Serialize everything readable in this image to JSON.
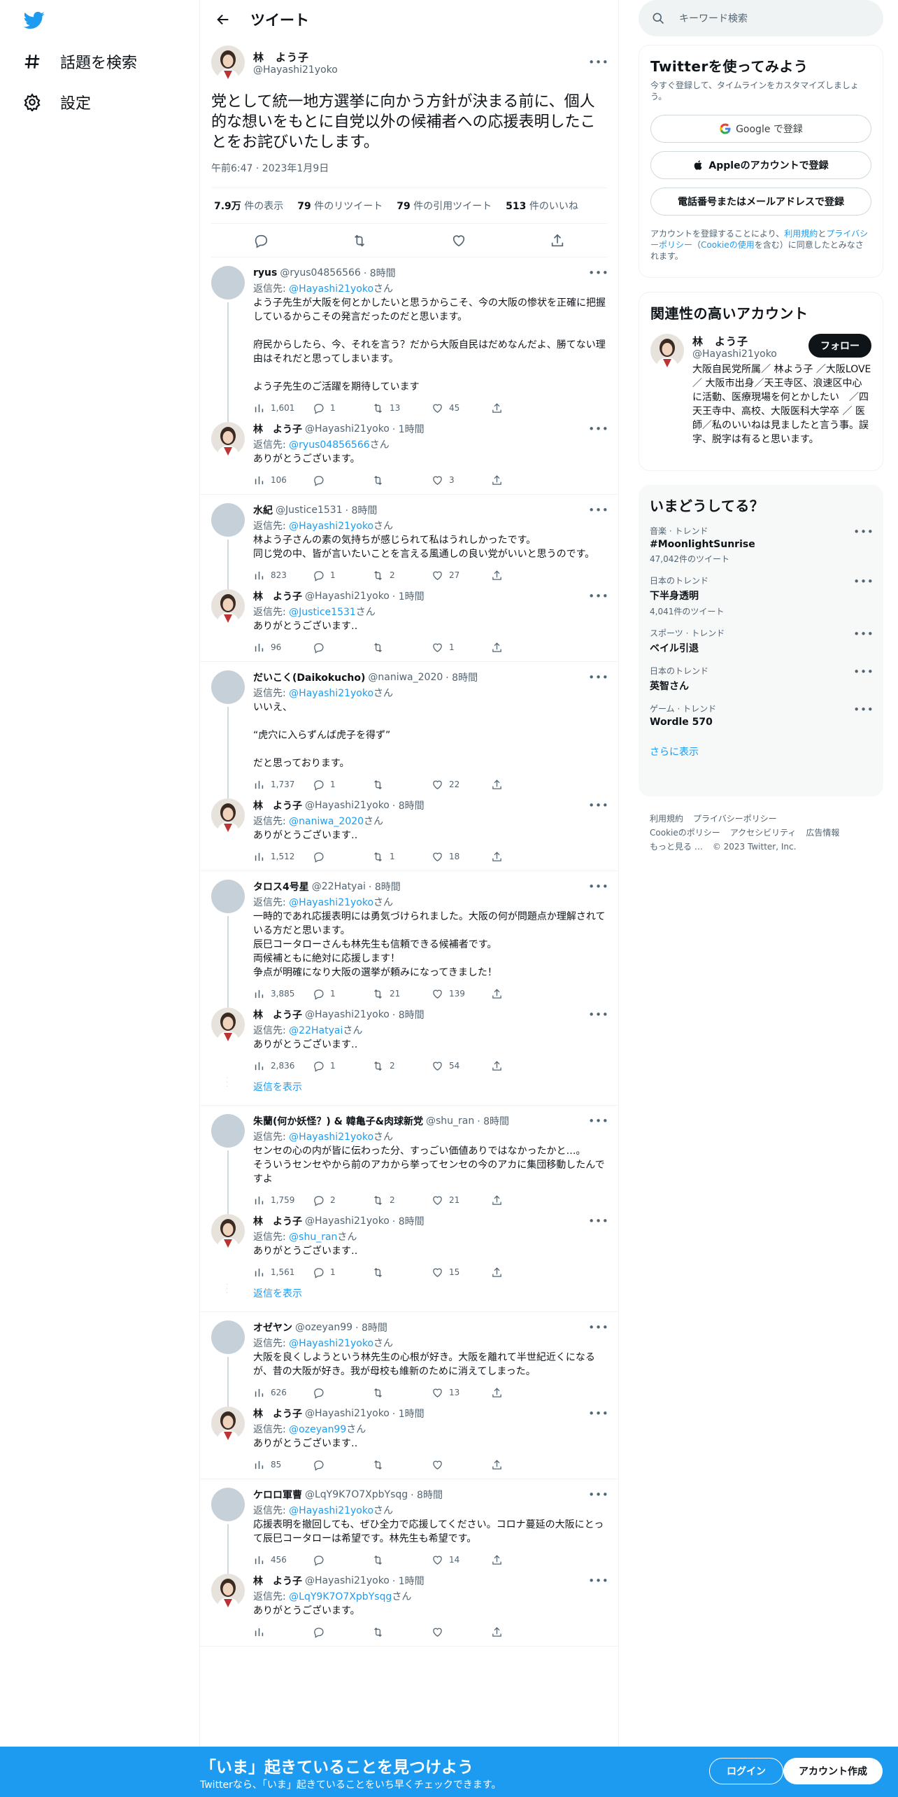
{
  "nav": {
    "explore": "話題を検索",
    "settings": "設定"
  },
  "header": {
    "title": "ツイート"
  },
  "main_tweet": {
    "name": "林　よう子",
    "handle": "@Hayashi21yoko",
    "text": "党として統一地方選挙に向かう方針が決まる前に、個人的な想いをもとに自党以外の候補者への応援表明したことをお詫びいたします。",
    "time": "午前6:47 · 2023年1月9日",
    "stats": {
      "views_num": "7.9万",
      "views_label": "件の表示",
      "retweets_num": "79",
      "retweets_label": "件のリツイート",
      "quotes_num": "79",
      "quotes_label": "件の引用ツイート",
      "likes_num": "513",
      "likes_label": "件のいいね"
    }
  },
  "reply_to_label": "返信先:",
  "san": "さん",
  "groups": [
    {
      "tweets": [
        {
          "name": "ryus",
          "handle": "@ryus04856566",
          "time": "· 8時間",
          "reply_to": "@Hayashi21yoko",
          "text": "よう子先生が大阪を何とかしたいと思うからこそ、今の大阪の惨状を正確に把握しているからこその発言だったのだと思います。\n\n府民からしたら、今、それを言う？だから大阪自民はだめなんだよ、勝てない理由はそれだと思ってしまいます。\n\nよう子先生のご活躍を期待しています",
          "views": "1,601",
          "replies": "1",
          "retweets": "13",
          "likes": "45",
          "author": false
        },
        {
          "name": "林　よう子",
          "handle": "@Hayashi21yoko",
          "time": "· 1時間",
          "reply_to": "@ryus04856566",
          "text": "ありがとうございます。",
          "views": "106",
          "replies": "",
          "retweets": "",
          "likes": "3",
          "author": true
        }
      ],
      "show_more": ""
    },
    {
      "tweets": [
        {
          "name": "水紀",
          "handle": "@Justice1531",
          "time": "· 8時間",
          "reply_to": "@Hayashi21yoko",
          "text": "林よう子さんの素の気持ちが感じられて私はうれしかったです。\n同じ党の中、皆が言いたいことを言える風通しの良い党がいいと思うのです。",
          "views": "823",
          "replies": "1",
          "retweets": "2",
          "likes": "27",
          "author": false
        },
        {
          "name": "林　よう子",
          "handle": "@Hayashi21yoko",
          "time": "· 1時間",
          "reply_to": "@Justice1531",
          "text": "ありがとうございます‥",
          "views": "96",
          "replies": "",
          "retweets": "",
          "likes": "1",
          "author": true
        }
      ],
      "show_more": ""
    },
    {
      "tweets": [
        {
          "name": "だいこく(Daikokucho)",
          "handle": "@naniwa_2020",
          "time": "· 8時間",
          "reply_to": "@Hayashi21yoko",
          "text": "いいえ、\n\n“虎穴に入らずんば虎子を得ず”\n\nだと思っております。",
          "views": "1,737",
          "replies": "1",
          "retweets": "",
          "likes": "22",
          "author": false
        },
        {
          "name": "林　よう子",
          "handle": "@Hayashi21yoko",
          "time": "· 8時間",
          "reply_to": "@naniwa_2020",
          "text": "ありがとうございます‥",
          "views": "1,512",
          "replies": "",
          "retweets": "1",
          "likes": "18",
          "author": true
        }
      ],
      "show_more": ""
    },
    {
      "tweets": [
        {
          "name": "タロス4号星",
          "handle": "@22Hatyai",
          "time": "· 8時間",
          "reply_to": "@Hayashi21yoko",
          "text": "一時的であれ応援表明には勇気づけられました。大阪の何が問題点か理解されている方だと思います。\n辰巳コータローさんも林先生も信頼できる候補者です。\n両候補ともに絶対に応援します！\n争点が明確になり大阪の選挙が頼みになってきました！",
          "views": "3,885",
          "replies": "1",
          "retweets": "21",
          "likes": "139",
          "author": false
        },
        {
          "name": "林　よう子",
          "handle": "@Hayashi21yoko",
          "time": "· 8時間",
          "reply_to": "@22Hatyai",
          "text": "ありがとうございます‥",
          "views": "2,836",
          "replies": "1",
          "retweets": "2",
          "likes": "54",
          "author": true
        }
      ],
      "show_more": "返信を表示"
    },
    {
      "tweets": [
        {
          "name": "朱蘭(何か妖怪？) & 韓亀子&肉球新党",
          "handle": "@shu_ran",
          "time": "· 8時間",
          "reply_to": "@Hayashi21yoko",
          "text": "センセの心の内が皆に伝わった分、すっごい価値ありではなかったかと…。\nそういうセンセやから前のアカから挙ってセンセの今のアカに集団移動したんですよ",
          "views": "1,759",
          "replies": "2",
          "retweets": "2",
          "likes": "21",
          "author": false
        },
        {
          "name": "林　よう子",
          "handle": "@Hayashi21yoko",
          "time": "· 8時間",
          "reply_to": "@shu_ran",
          "text": "ありがとうございます‥",
          "views": "1,561",
          "replies": "1",
          "retweets": "",
          "likes": "15",
          "author": true
        }
      ],
      "show_more": "返信を表示"
    },
    {
      "tweets": [
        {
          "name": "オゼヤン",
          "handle": "@ozeyan99",
          "time": "· 8時間",
          "reply_to": "@Hayashi21yoko",
          "text": "大阪を良くしようという林先生の心根が好き。大阪を離れて半世紀近くになるが、昔の大阪が好き。我が母校も維新のために消えてしまった。",
          "views": "626",
          "replies": "",
          "retweets": "",
          "likes": "13",
          "author": false
        },
        {
          "name": "林　よう子",
          "handle": "@Hayashi21yoko",
          "time": "· 1時間",
          "reply_to": "@ozeyan99",
          "text": "ありがとうございます‥",
          "views": "85",
          "replies": "",
          "retweets": "",
          "likes": "",
          "author": true
        }
      ],
      "show_more": ""
    },
    {
      "tweets": [
        {
          "name": "ケロロ軍曹",
          "handle": "@LqY9K7O7XpbYsqg",
          "time": "· 8時間",
          "reply_to": "@Hayashi21yoko",
          "text": "応援表明を撤回しても、ぜひ全力で応援してください。コロナ蔓延の大阪にとって辰巳コータローは希望です。林先生も希望です。",
          "views": "456",
          "replies": "",
          "retweets": "",
          "likes": "14",
          "author": false
        },
        {
          "name": "林　よう子",
          "handle": "@Hayashi21yoko",
          "time": "· 1時間",
          "reply_to": "@LqY9K7O7XpbYsqg",
          "text": "ありがとうございます。",
          "views": "",
          "replies": "",
          "retweets": "",
          "likes": "",
          "author": true
        }
      ],
      "show_more": ""
    }
  ],
  "sidebar": {
    "search_placeholder": "キーワード検索",
    "signup": {
      "title": "Twitterを使ってみよう",
      "subtitle": "今すぐ登録して、タイムラインをカスタマイズしましょう。",
      "google": "Google で登録",
      "apple": "Appleのアカウントで登録",
      "phone": "電話番号またはメールアドレスで登録",
      "terms_1": "アカウントを登録することにより、",
      "terms_link1": "利用規約",
      "terms_2": "と",
      "terms_link2": "プライバシーポリシー",
      "terms_3": "（",
      "terms_link3": "Cookieの使用",
      "terms_4": "を含む）に同意したとみなされます。"
    },
    "related": {
      "title": "関連性の高いアカウント",
      "name": "林　よう子",
      "handle": "@Hayashi21yoko",
      "follow": "フォロー",
      "bio": "大阪自民党所属／ 林よう子 ／大阪LOVE ／ 大阪市出身／天王寺区、浪速区中心に活動、医療現場を何とかしたい　／四天王寺中、高校、大阪医科大学卒 ／ 医師／私のいいねは見ましたと言う事。誤字、脱字は有ると思います。"
    },
    "trends": {
      "title": "いまどうしてる？",
      "items": [
        {
          "category": "音楽 · トレンド",
          "name": "#MoonlightSunrise",
          "count": "47,042件のツイート"
        },
        {
          "category": "日本のトレンド",
          "name": "下半身透明",
          "count": "4,041件のツイート"
        },
        {
          "category": "スポーツ · トレンド",
          "name": "ベイル引退",
          "count": ""
        },
        {
          "category": "日本のトレンド",
          "name": "英智さん",
          "count": ""
        },
        {
          "category": "ゲーム · トレンド",
          "name": "Wordle 570",
          "count": ""
        }
      ],
      "show_more": "さらに表示"
    },
    "footer": {
      "terms": "利用規約",
      "privacy": "プライバシーポリシー",
      "cookie": "Cookieのポリシー",
      "accessibility": "アクセシビリティ",
      "ads": "広告情報",
      "more": "もっと見る …",
      "copyright": "© 2023 Twitter, Inc."
    }
  },
  "bottom_bar": {
    "title": "「いま」起きていることを見つけよう",
    "subtitle": "Twitterなら、「いま」起きていることをいち早くチェックできます。",
    "login": "ログイン",
    "signup": "アカウント作成"
  },
  "colors": {
    "accent": "#1d9bf0",
    "text": "#0f1419",
    "muted": "#536471"
  }
}
